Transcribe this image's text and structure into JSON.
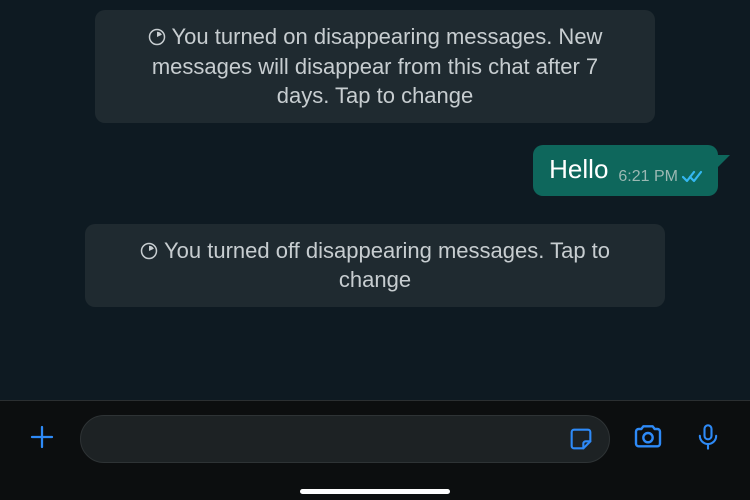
{
  "system_messages": {
    "on": "You turned on disappearing messages. New messages will disappear from this chat after 7 days. Tap to change",
    "off": "You turned off disappearing messages. Tap to change"
  },
  "outgoing": {
    "text": "Hello",
    "time": "6:21 PM"
  },
  "input": {
    "placeholder": ""
  },
  "colors": {
    "background": "#0e1a22",
    "system_bubble": "#1f2a30",
    "outgoing_bubble": "#0e675c",
    "input_bar": "#0c0e0f",
    "accent": "#2e8af7",
    "read_ticks": "#34b7f1"
  }
}
